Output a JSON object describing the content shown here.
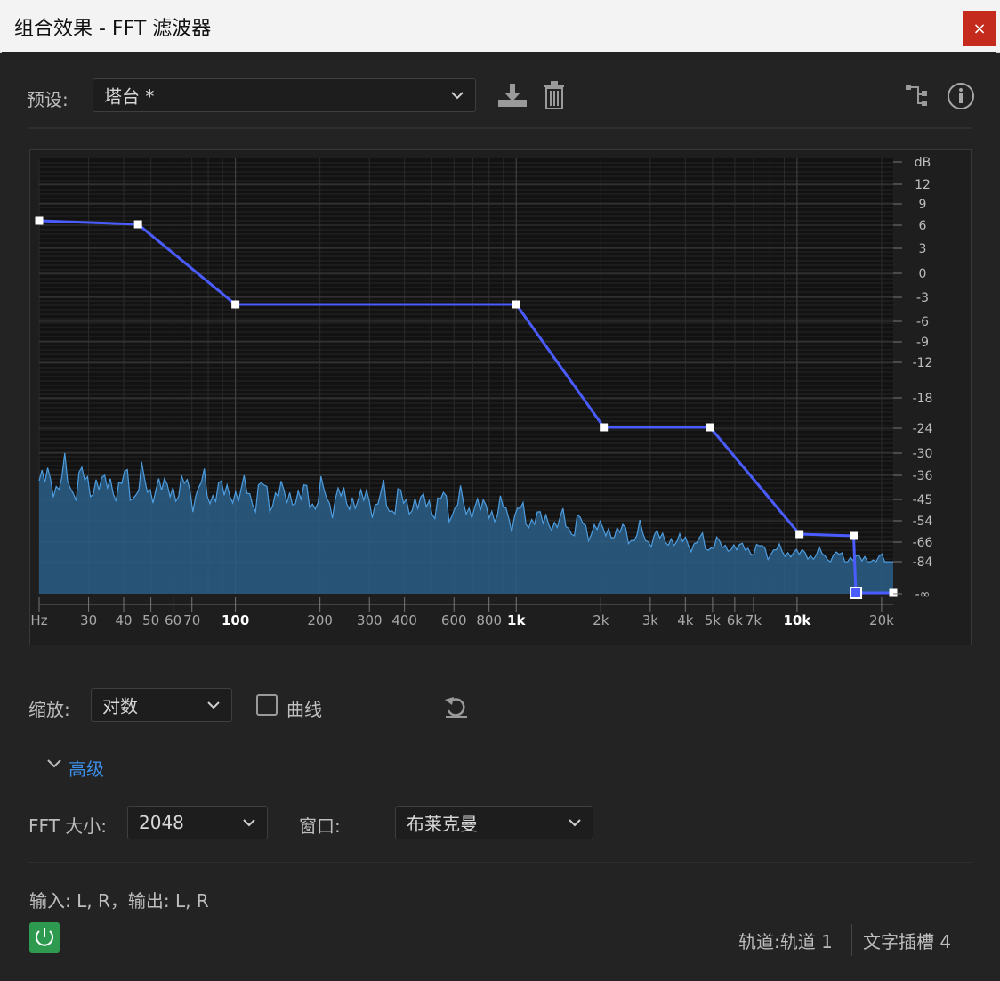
{
  "window": {
    "title": "组合效果 - FFT 滤波器",
    "close_label": "×"
  },
  "preset": {
    "label": "预设:",
    "value": "塔台 *"
  },
  "graph": {
    "db_ticks": [
      {
        "label": "dB",
        "db": null
      },
      {
        "label": "12",
        "db": 12
      },
      {
        "label": "9",
        "db": 9
      },
      {
        "label": "6",
        "db": 6
      },
      {
        "label": "3",
        "db": 3
      },
      {
        "label": "0",
        "db": 0
      },
      {
        "label": "-3",
        "db": -3
      },
      {
        "label": "-6",
        "db": -6
      },
      {
        "label": "-9",
        "db": -9
      },
      {
        "label": "-12",
        "db": -12
      },
      {
        "label": "-18",
        "db": -18
      },
      {
        "label": "-24",
        "db": -24
      },
      {
        "label": "-30",
        "db": -30
      },
      {
        "label": "-36",
        "db": -36
      },
      {
        "label": "-45",
        "db": -45
      },
      {
        "label": "-54",
        "db": -54
      },
      {
        "label": "-66",
        "db": -66
      },
      {
        "label": "-84",
        "db": -84
      },
      {
        "label": "-∞",
        "db": -999
      }
    ],
    "freq_ticks": [
      {
        "label": "Hz",
        "f": 20,
        "bold": false
      },
      {
        "label": "30",
        "f": 30,
        "bold": false
      },
      {
        "label": "40",
        "f": 40,
        "bold": false
      },
      {
        "label": "50",
        "f": 50,
        "bold": false
      },
      {
        "label": "60",
        "f": 60,
        "bold": false
      },
      {
        "label": "70",
        "f": 70,
        "bold": false
      },
      {
        "label": "100",
        "f": 100,
        "bold": true
      },
      {
        "label": "200",
        "f": 200,
        "bold": false
      },
      {
        "label": "300",
        "f": 300,
        "bold": false
      },
      {
        "label": "400",
        "f": 400,
        "bold": false
      },
      {
        "label": "600",
        "f": 600,
        "bold": false
      },
      {
        "label": "800",
        "f": 800,
        "bold": false
      },
      {
        "label": "1k",
        "f": 1000,
        "bold": true
      },
      {
        "label": "2k",
        "f": 2000,
        "bold": false
      },
      {
        "label": "3k",
        "f": 3000,
        "bold": false
      },
      {
        "label": "4k",
        "f": 4000,
        "bold": false
      },
      {
        "label": "5k",
        "f": 5000,
        "bold": false
      },
      {
        "label": "6k",
        "f": 6000,
        "bold": false
      },
      {
        "label": "7k",
        "f": 7000,
        "bold": false
      },
      {
        "label": "10k",
        "f": 10000,
        "bold": true
      },
      {
        "label": "20k",
        "f": 20000,
        "bold": false
      }
    ],
    "curve_points": [
      {
        "f": 20,
        "db": 6.5
      },
      {
        "f": 45,
        "db": 6
      },
      {
        "f": 100,
        "db": -4
      },
      {
        "f": 1000,
        "db": -4
      },
      {
        "f": 2050,
        "db": -24
      },
      {
        "f": 4900,
        "db": -24
      },
      {
        "f": 10200,
        "db": -62
      },
      {
        "f": 15900,
        "db": -63
      },
      {
        "f": 16200,
        "db": -999
      },
      {
        "f": 22000,
        "db": -999
      }
    ],
    "selected_point_index": 8,
    "colors": {
      "curve": "#4a5cff",
      "spectrum_fill": "#2c5f88",
      "spectrum_line": "#4d9de0",
      "handle": "#ffffff"
    }
  },
  "scale": {
    "label": "缩放:",
    "value": "对数",
    "curve_label": "曲线",
    "curve_checked": false
  },
  "advanced": {
    "label": "高级"
  },
  "fft": {
    "label": "FFT 大小:",
    "value": "2048"
  },
  "window_fn": {
    "label": "窗口:",
    "value": "布莱克曼"
  },
  "io": {
    "text": "输入: L, R，输出: L, R"
  },
  "status": {
    "track": "轨道:轨道 1",
    "slot": "文字插槽 4"
  },
  "accent": "#3d8ee6"
}
